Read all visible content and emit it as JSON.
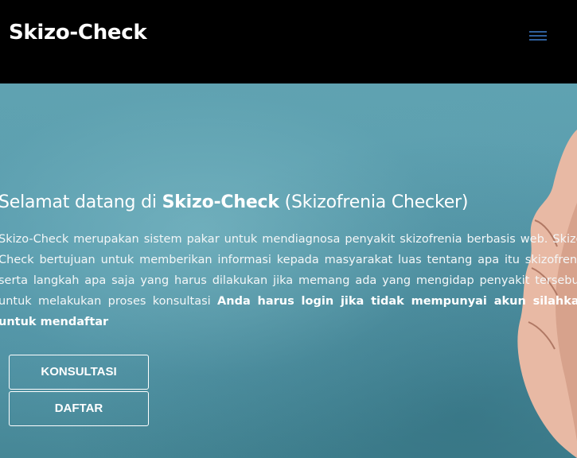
{
  "navbar": {
    "brand": "Skizo-Check",
    "menu_icon": "hamburger-menu-icon"
  },
  "hero": {
    "title_prefix": "Selamat datang di ",
    "title_brand": "Skizo-Check",
    "title_suffix": " (Skizofrenia Checker)",
    "description_text": "Skizo-Check merupakan sistem pakar untuk mendiagnosa penyakit skizofrenia berbasis web. Skizo-Check bertujuan untuk memberikan informasi kepada masyarakat luas tentang apa itu skizofrenia serta langkah apa saja yang harus dilakukan jika memang ada yang mengidap penyakit tersebut. untuk melakukan proses konsultasi ",
    "description_bold": "Anda harus login jika tidak mempunyai akun silahkan untuk mendaftar",
    "buttons": {
      "konsultasi": "KONSULTASI",
      "daftar": "DAFTAR"
    }
  },
  "colors": {
    "navbar_bg": "#000000",
    "hero_bg": "#5a9daf",
    "menu_icon": "#2f5f9c"
  }
}
